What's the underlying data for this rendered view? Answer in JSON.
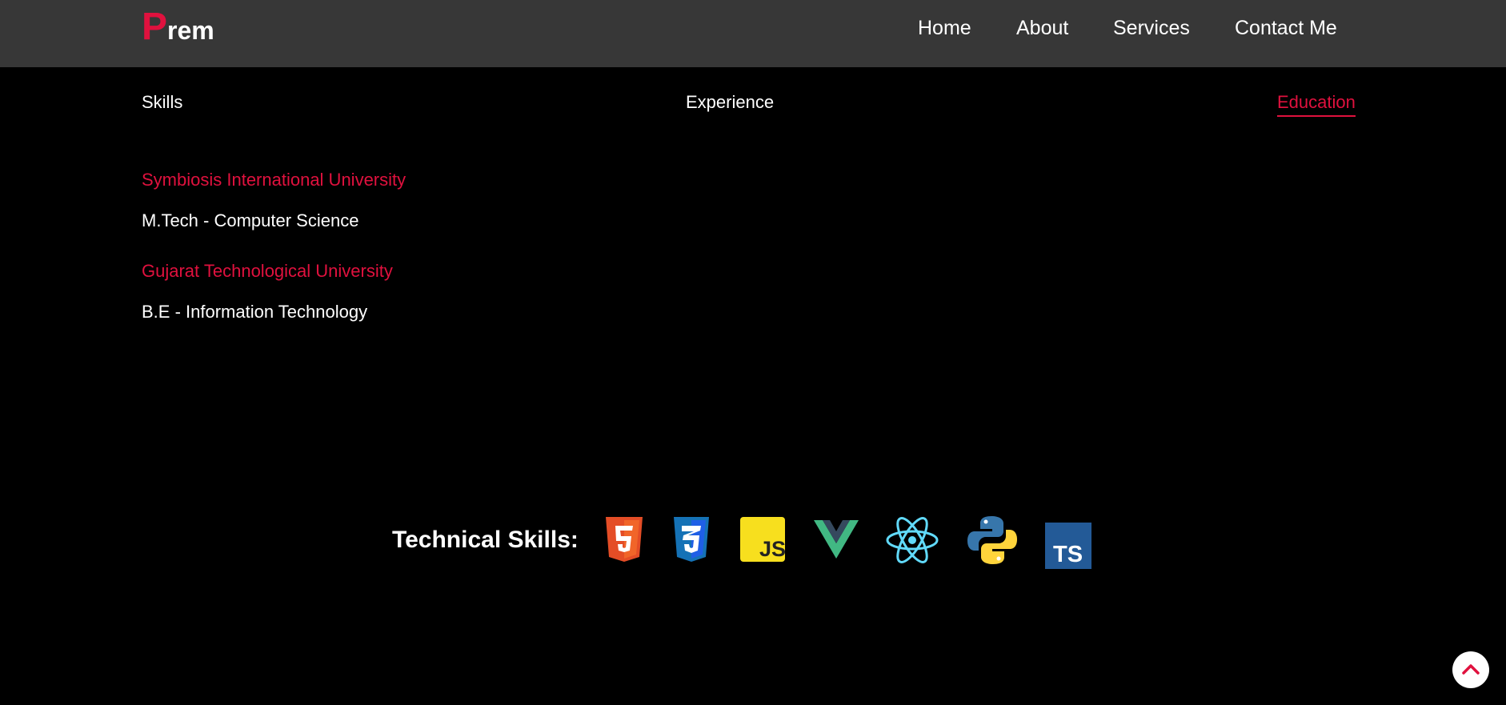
{
  "logo": {
    "first_letter": "P",
    "rest": "rem"
  },
  "nav": {
    "home": "Home",
    "about": "About",
    "services": "Services",
    "contact": "Contact Me"
  },
  "tabs": {
    "skills": "Skills",
    "experience": "Experience",
    "education": "Education",
    "active": "Education"
  },
  "education": [
    {
      "institution": "Symbiosis International University",
      "degree": "M.Tech - Computer Science"
    },
    {
      "institution": "Gujarat Technological University",
      "degree": "B.E - Information Technology"
    }
  ],
  "technical_skills": {
    "label": "Technical Skills:",
    "icons": [
      "html5-icon",
      "css3-icon",
      "javascript-icon",
      "vue-icon",
      "react-icon",
      "python-icon",
      "typescript-icon"
    ],
    "js_text": "JS",
    "ts_text": "TS"
  },
  "colors": {
    "accent": "#e0113e",
    "navbar": "#373737",
    "background": "#000000"
  },
  "back_to_top_icon": "chevron-up-icon"
}
